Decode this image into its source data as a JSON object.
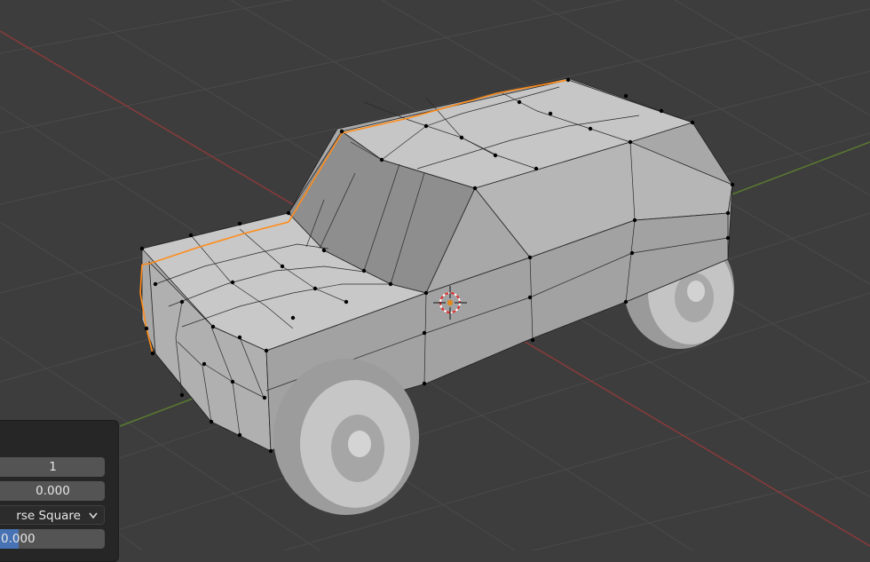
{
  "viewport": {
    "grid_color": "#4a4a4a",
    "x_axis_color": "#8a3a3a",
    "y_axis_color": "#5a7a30",
    "mesh_color": "#bfbfbf",
    "selected_edge_color": "#ff8c1a",
    "vertex_color": "#000000"
  },
  "operator_panel": {
    "field_1_value": "1",
    "field_2_value": "0.000",
    "falloff_value": "rse Square",
    "field_4_value": "0.000"
  }
}
